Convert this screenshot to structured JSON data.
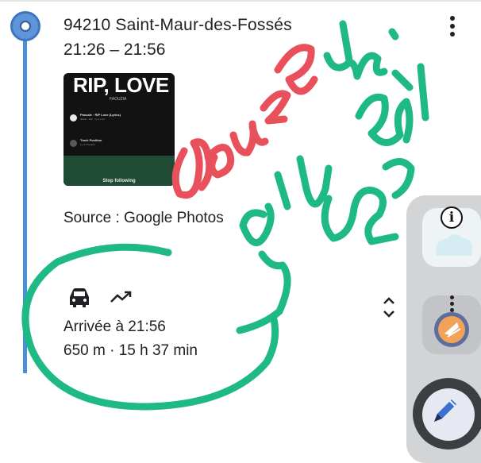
{
  "timeline": {
    "address": "94210 Saint-Maur-des-Fossés",
    "time_range": "21:26 – 21:56"
  },
  "photo": {
    "title": "RIP, LOVE",
    "subtitle": "FAOUZIA",
    "rows": [
      {
        "title": "Pascale · RIP Love (Lyrics)",
        "sub": "Ghost · 12k · il y a 1 an"
      },
      {
        "title": "Track Position",
        "sub": "il y a 3 heures"
      }
    ],
    "button": "Stop following"
  },
  "source_label": "Source : Google Photos",
  "trip": {
    "arrival": "Arrivée à 21:56",
    "distance_duration": "650 m · 15 h 37 min"
  },
  "icons": {
    "timeline_node": "timeline-location-icon",
    "more": "more-vert-icon",
    "car": "car-icon",
    "trend": "trending-icon",
    "expand": "unfold-icon",
    "info": "info-icon",
    "app": "app-launcher-icon",
    "pen": "edit-pen-icon"
  },
  "colors": {
    "timeline_blue": "#4a90d9",
    "ink_red": "#e8505b",
    "ink_green": "#1fb987",
    "side_panel": "#d3d4d6"
  },
  "annotations": {
    "red_handwriting": "bouze",
    "green_handwriting_1": "ils",
    "green_handwriting_2": "ou alors"
  }
}
